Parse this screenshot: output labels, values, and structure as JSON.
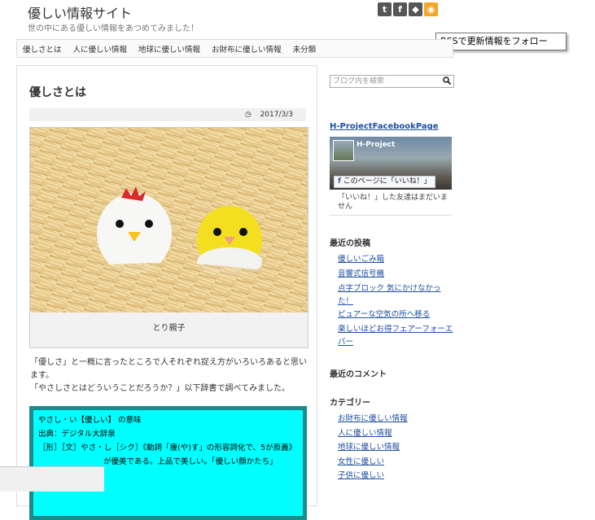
{
  "site": {
    "title": "優しい情報サイト",
    "tagline": "世の中にある優しい情報をあつめてみました！"
  },
  "tooltip": "RSSで更新情報をフォロー",
  "social": {
    "icons": [
      {
        "name": "twitter-icon",
        "glyph": "t",
        "color": "#555555"
      },
      {
        "name": "facebook-icon",
        "glyph": "f",
        "color": "#555555"
      },
      {
        "name": "feedly-icon",
        "glyph": "◆",
        "color": "#555555"
      },
      {
        "name": "rss-icon",
        "glyph": "◉",
        "color": "#f5a623"
      }
    ]
  },
  "nav": [
    "優しさとは",
    "人に優しい情報",
    "地球に優しい情報",
    "お財布に優しい情報",
    "未分類"
  ],
  "post": {
    "title": "優しさとは",
    "date": "2017/3/3",
    "image_caption": "とり親子",
    "body": [
      "「優しさ」と一概に言ったところで人それぞれ捉え方がいろいろあると思います。",
      "「やさしさとはどういうことだろうか？」以下辞書で調べてみました。"
    ],
    "quote": [
      "やさし・い【優しい】 の意味",
      "出典：デジタル大辞泉",
      "［形］［文］やさ・し［シク］《動詞「痩(や)す」の形容詞化で、5が原義》",
      "が優美である。上品で美しい。「優しい顔かたち」"
    ]
  },
  "sidebar": {
    "search_placeholder": "ブログ内を検索",
    "fb_title": "H-ProjectFacebookPage",
    "fb_page_name": "H-Project",
    "fb_like": "このページに「いいね！」",
    "fb_text": "「いいね！」した友達はまだいません",
    "recent_posts_title": "最近の投稿",
    "recent_posts": [
      "優しいごみ箱",
      "音響式信号機",
      "点字ブロック 気にかけなかった！",
      "ピュアーな空気の所へ移る",
      "楽しいほどお得フェアーフォーエバー"
    ],
    "recent_comments_title": "最近のコメント",
    "categories_title": "カテゴリー",
    "categories": [
      "お財布に優しい情報",
      "人に優しい情報",
      "地球に優しい情報",
      "女性に優しい",
      "子供に優しい"
    ]
  }
}
